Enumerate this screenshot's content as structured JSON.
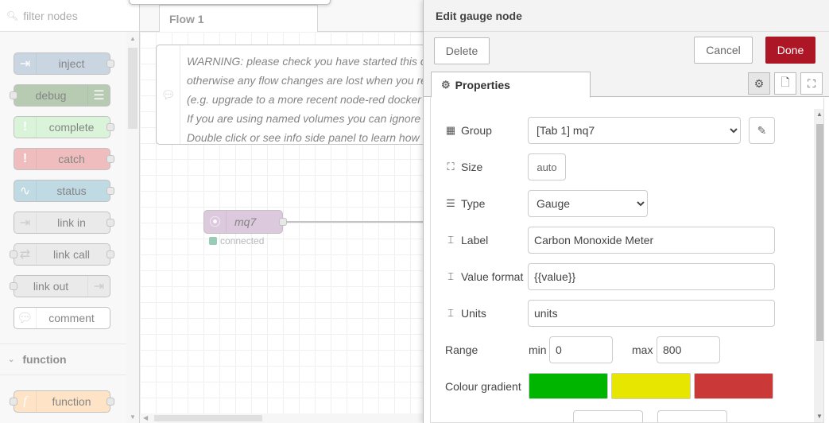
{
  "palette": {
    "search_placeholder": "filter nodes",
    "nodes": [
      {
        "label": "inject",
        "color": "#a6bbcf"
      },
      {
        "label": "debug",
        "color": "#87a980"
      },
      {
        "label": "complete",
        "color": "#c0edc0"
      },
      {
        "label": "catch",
        "color": "#e49191"
      },
      {
        "label": "status",
        "color": "#94c1d0"
      },
      {
        "label": "link in",
        "color": "#dddddd"
      },
      {
        "label": "link call",
        "color": "#dddddd"
      },
      {
        "label": "link out",
        "color": "#dddddd"
      },
      {
        "label": "comment",
        "color": "#ffffff"
      }
    ],
    "category": "function",
    "function_node": {
      "label": "function",
      "color": "#fdd0a2"
    }
  },
  "workspace": {
    "tab": "Flow 1",
    "comment_lines": [
      "WARNING: please check you have started this c",
      "otherwise any flow changes are lost when you re",
      "(e.g. upgrade to a more recent node-red docker",
      "If you are using named volumes you can ignore",
      "Double click or see info side panel to learn how"
    ],
    "mq7_node": {
      "label": "mq7",
      "status": "connected"
    }
  },
  "tray": {
    "title": "Edit gauge node",
    "delete_label": "Delete",
    "cancel_label": "Cancel",
    "done_label": "Done",
    "properties_tab": "Properties",
    "fields": {
      "group": {
        "label": "Group",
        "value": "[Tab 1] mq7"
      },
      "size": {
        "label": "Size",
        "value": "auto"
      },
      "type": {
        "label": "Type",
        "value": "Gauge"
      },
      "label": {
        "label": "Label",
        "value": "Carbon Monoxide Meter"
      },
      "value_format": {
        "label": "Value format",
        "value": "{{value}}"
      },
      "units": {
        "label": "Units",
        "value": "units"
      },
      "range": {
        "label": "Range",
        "min_label": "min",
        "min": "0",
        "max_label": "max",
        "max": "800"
      },
      "colour_gradient": {
        "label": "Colour gradient",
        "colors": [
          "#00b500",
          "#e6e600",
          "#ca3838"
        ]
      }
    }
  }
}
